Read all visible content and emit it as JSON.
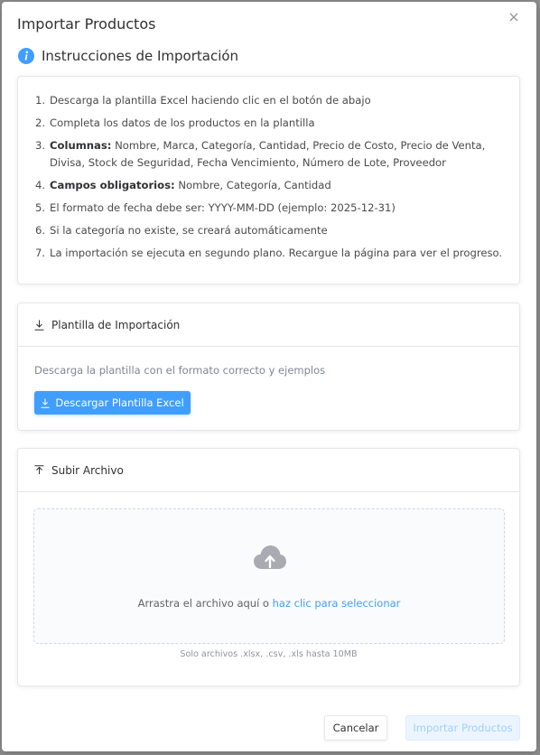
{
  "dialog": {
    "title": "Importar Productos",
    "close_icon": "close-icon"
  },
  "instructions": {
    "heading": "Instrucciones de Importación",
    "heading_icon": "info-icon",
    "items": [
      {
        "num": "1.",
        "label": "",
        "text": "Descarga la plantilla Excel haciendo clic en el botón de abajo"
      },
      {
        "num": "2.",
        "label": "",
        "text": "Completa los datos de los productos en la plantilla"
      },
      {
        "num": "3.",
        "label": "Columnas:",
        "text": " Nombre, Marca, Categoría, Cantidad, Precio de Costo, Precio de Venta, Divisa, Stock de Seguridad, Fecha Vencimiento, Número de Lote, Proveedor"
      },
      {
        "num": "4.",
        "label": "Campos obligatorios:",
        "text": " Nombre, Categoría, Cantidad"
      },
      {
        "num": "5.",
        "label": "",
        "text": "El formato de fecha debe ser: YYYY-MM-DD (ejemplo: 2025-12-31)"
      },
      {
        "num": "6.",
        "label": "",
        "text": "Si la categoría no existe, se creará automáticamente"
      },
      {
        "num": "7.",
        "label": "",
        "text": "La importación se ejecuta en segundo plano. Recargue la página para ver el progreso."
      }
    ]
  },
  "template": {
    "header": "Plantilla de Importación",
    "header_icon": "download-icon",
    "description": "Descarga la plantilla con el formato correcto y ejemplos",
    "button_label": "Descargar Plantilla Excel"
  },
  "upload": {
    "header": "Subir Archivo",
    "header_icon": "upload-icon",
    "drop_text": "Arrastra el archivo aquí o ",
    "drop_link": "haz clic para seleccionar",
    "drop_icon": "cloud-upload-icon",
    "tip": "Solo archivos .xlsx, .csv, .xls hasta 10MB"
  },
  "footer": {
    "cancel_label": "Cancelar",
    "import_label": "Importar Productos"
  },
  "colors": {
    "primary": "#409eff",
    "primary_disabled_bg": "#ecf5ff",
    "primary_disabled_text": "#a0cfff",
    "backdrop": "#8f8f8f"
  }
}
